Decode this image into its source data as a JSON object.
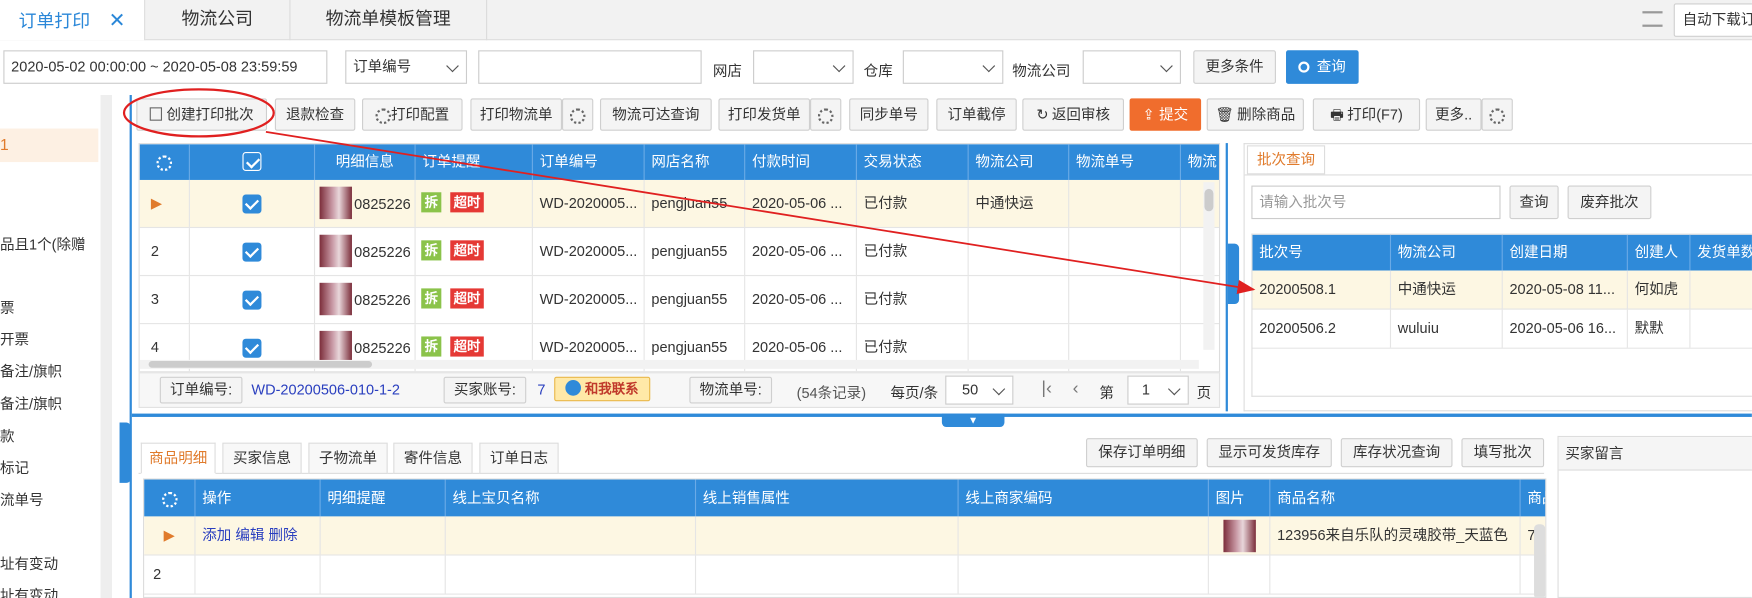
{
  "tabs": {
    "order_print": "订单打印",
    "logistics_company": "物流公司",
    "template_mgmt": "物流单模板管理",
    "auto_download": "自动下载订"
  },
  "filter": {
    "date_range": "2020-05-02 00:00:00 ~ 2020-05-08 23:59:59",
    "order_field": "订单编号",
    "shop_label": "网店",
    "warehouse_label": "仓库",
    "logistics_label": "物流公司",
    "more_conditions": "更多条件",
    "search": "查询"
  },
  "sidebar": {
    "items": [
      "品且1个(除赠",
      "票",
      "开票",
      "备注/旗帜",
      "备注/旗帜",
      "款",
      "标记",
      "流单号",
      "址有变动",
      "址有变动"
    ]
  },
  "toolbar": {
    "create_batch": "创建打印批次",
    "refund_check": "退款检查",
    "print_config": "打印配置",
    "print_waybill": "打印物流单",
    "logistics_reach": "物流可达查询",
    "print_invoice": "打印发货单",
    "sync_number": "同步单号",
    "order_intercept": "订单截停",
    "return_review": "返回审核",
    "submit": "提交",
    "delete_goods": "删除商品",
    "print_f7": "打印(F7)",
    "more": "更多.."
  },
  "orders": {
    "headers": [
      "明细信息",
      "订单提醒",
      "订单编号",
      "网店名称",
      "付款时间",
      "交易状态",
      "物流公司",
      "物流单号",
      "物流"
    ],
    "rows": [
      {
        "idx": "",
        "detail": "0825226",
        "split": "拆",
        "overtime": "超时",
        "order_no": "WD-2020005...",
        "shop": "pengjuan55",
        "pay_time": "2020-05-06 ...",
        "status": "已付款",
        "logistics": "中通快运"
      },
      {
        "idx": "2",
        "detail": "0825226",
        "split": "拆",
        "overtime": "超时",
        "order_no": "WD-2020005...",
        "shop": "pengjuan55",
        "pay_time": "2020-05-06 ...",
        "status": "已付款",
        "logistics": ""
      },
      {
        "idx": "3",
        "detail": "0825226",
        "split": "拆",
        "overtime": "超时",
        "order_no": "WD-2020005...",
        "shop": "pengjuan55",
        "pay_time": "2020-05-06 ...",
        "status": "已付款",
        "logistics": ""
      },
      {
        "idx": "4",
        "detail": "0825226",
        "split": "拆",
        "overtime": "超时",
        "order_no": "WD-2020005...",
        "shop": "pengjuan55",
        "pay_time": "2020-05-06 ...",
        "status": "已付款",
        "logistics": ""
      }
    ]
  },
  "footer": {
    "order_no_label": "订单编号:",
    "order_no_value": "WD-20200506-010-1-2",
    "buyer_label": "买家账号:",
    "buyer_value": "7",
    "contact": "和我联系",
    "waybill_label": "物流单号:",
    "records": "(54条记录)",
    "per_page_label": "每页/条",
    "per_page": "50",
    "page_label": "第",
    "page": "1",
    "page_unit": "页"
  },
  "batch": {
    "tab": "批次查询",
    "placeholder": "请输入批次号",
    "search": "查询",
    "discard": "废弃批次",
    "headers": [
      "批次号",
      "物流公司",
      "创建日期",
      "创建人",
      "发货单数"
    ],
    "rows": [
      [
        "20200508.1",
        "中通快运",
        "2020-05-08 11...",
        "何如虎",
        ""
      ],
      [
        "20200506.2",
        "wuluiu",
        "2020-05-06 16...",
        "默默",
        ""
      ]
    ]
  },
  "detail": {
    "tabs": [
      "商品明细",
      "买家信息",
      "子物流单",
      "寄件信息",
      "订单日志"
    ],
    "actions": [
      "保存订单明细",
      "显示可发货库存",
      "库存状况查询",
      "填写批次"
    ],
    "buyer_msg": "买家留言",
    "headers": [
      "操作",
      "明细提醒",
      "线上宝贝名称",
      "线上销售属性",
      "线上商家编码",
      "图片",
      "商品名称",
      "商品"
    ],
    "row1": {
      "add": "添加",
      "edit": "编辑",
      "delete": "删除",
      "name": "123956来自乐队的灵魂胶带_天蓝色",
      "qty": "7"
    },
    "row2_idx": "2"
  },
  "colors": {
    "accent": "#2f8ad9",
    "submit": "#f06d2d",
    "red_tag": "#e53935",
    "green_tag": "#8bc34a",
    "annotation": "#e02020"
  }
}
